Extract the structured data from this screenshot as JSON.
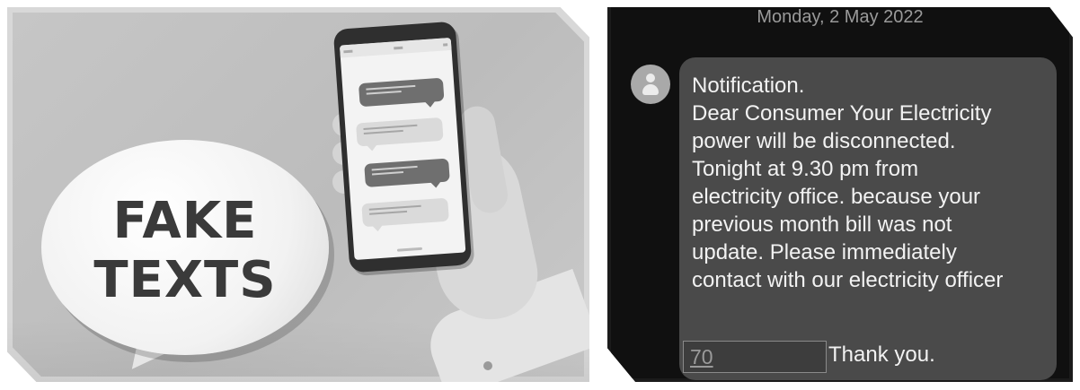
{
  "left_illustration": {
    "bubble_line1": "FAKE",
    "bubble_line2": "TEXTS"
  },
  "right_screenshot": {
    "date_header": "Monday, 2 May 2022",
    "message_lines": [
      "Notification.",
      "Dear Consumer Your Electricity",
      "power will be disconnected.",
      "Tonight at 9.30 pm from",
      "electricity office. because your",
      "previous month bill was not",
      "update. Please immediately",
      "contact with our electricity officer"
    ],
    "redacted_number_prefix": "70",
    "closing": "Thank you."
  }
}
